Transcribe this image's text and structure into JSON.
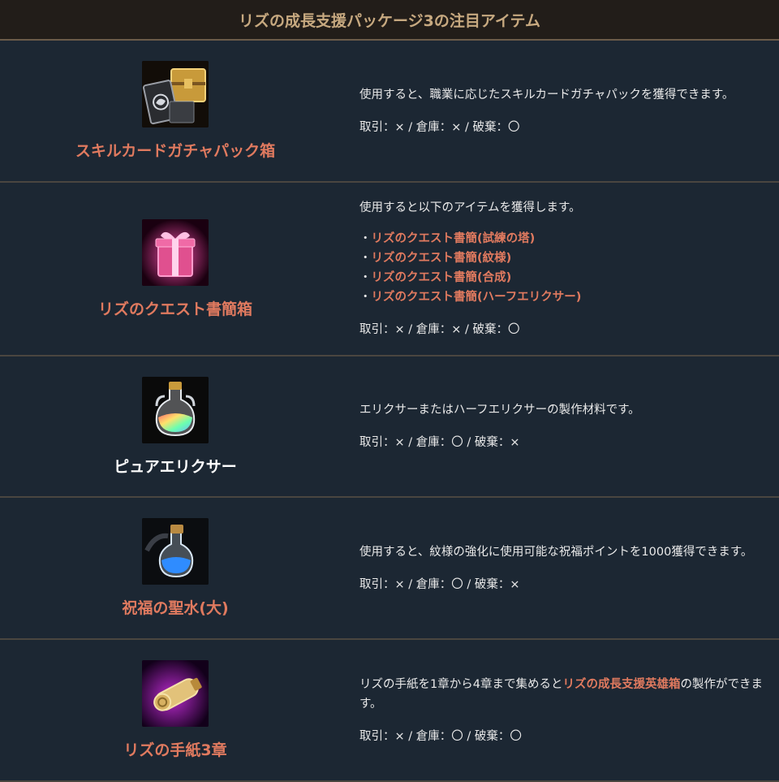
{
  "page": {
    "title": "リズの成長支援パッケージ3の注目アイテム"
  },
  "items": [
    {
      "name": "スキルカードガチャパック箱",
      "icon": "card-chest-icon",
      "desc": "使用すると、職業に応じたスキルカードガチャパックを獲得できます。",
      "trade": "取引：× / 倉庫：× / 破棄：〇"
    },
    {
      "name": "リズのクエスト書簡箱",
      "icon": "gift-box-icon",
      "desc": "使用すると以下のアイテムを獲得します。",
      "bullet": "・",
      "contents": [
        "リズのクエスト書簡(試練の塔)",
        "リズのクエスト書簡(紋様)",
        "リズのクエスト書簡(合成)",
        "リズのクエスト書簡(ハーフエリクサー)"
      ],
      "trade": "取引：× / 倉庫：× / 破棄：〇"
    },
    {
      "name": "ピュアエリクサー",
      "icon": "potion-flask-icon",
      "desc": "エリクサーまたはハーフエリクサーの製作材料です。",
      "trade": "取引：× / 倉庫：〇 / 破棄：×"
    },
    {
      "name": "祝福の聖水(大)",
      "icon": "holy-water-icon",
      "desc": "使用すると、紋様の強化に使用可能な祝福ポイントを1000獲得できます。",
      "trade": "取引：× / 倉庫：〇 / 破棄：×"
    },
    {
      "name": "リズの手紙3章",
      "icon": "scroll-icon",
      "desc_pre": "リズの手紙を1章から4章まで集めると",
      "desc_hl": "リズの成長支援英雄箱",
      "desc_post": "の製作ができます。",
      "trade": "取引：× / 倉庫：〇 / 破棄：〇"
    }
  ],
  "colors": {
    "background": "#1c2733",
    "header_bg": "#221d19",
    "header_text": "#c7a980",
    "accent": "#e07a5f"
  }
}
